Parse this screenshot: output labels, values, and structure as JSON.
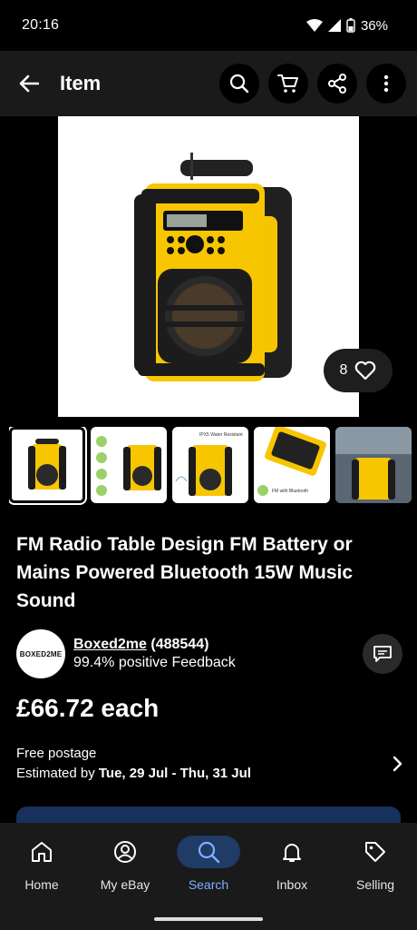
{
  "status_bar": {
    "time": "20:16",
    "battery": "36%"
  },
  "appbar": {
    "title": "Item"
  },
  "hero": {
    "watch_count": "8"
  },
  "thumbnails": [
    {
      "caption": ""
    },
    {
      "caption": ""
    },
    {
      "caption": "IPX5 Water Resistant"
    },
    {
      "caption": "FM with Bluetooth"
    },
    {
      "caption": ""
    }
  ],
  "listing": {
    "title": "FM Radio Table Design FM Battery or Mains Powered Bluetooth 15W Music Sound",
    "price": "£66.72 each"
  },
  "seller": {
    "logo_text": "BOXED2ME",
    "name": "Boxed2me",
    "score": " (488544)",
    "feedback": "99.4% positive Feedback"
  },
  "shipping": {
    "postage": "Free postage",
    "estimate_prefix": "Estimated by ",
    "estimate_dates": "Tue, 29 Jul - Thu, 31 Jul"
  },
  "bottom_nav": {
    "items": [
      {
        "label": "Home",
        "icon": "home-icon"
      },
      {
        "label": "My eBay",
        "icon": "account-icon"
      },
      {
        "label": "Search",
        "icon": "search-icon"
      },
      {
        "label": "Inbox",
        "icon": "bell-icon"
      },
      {
        "label": "Selling",
        "icon": "tag-icon"
      }
    ],
    "active_color": "#7fb0ff"
  }
}
